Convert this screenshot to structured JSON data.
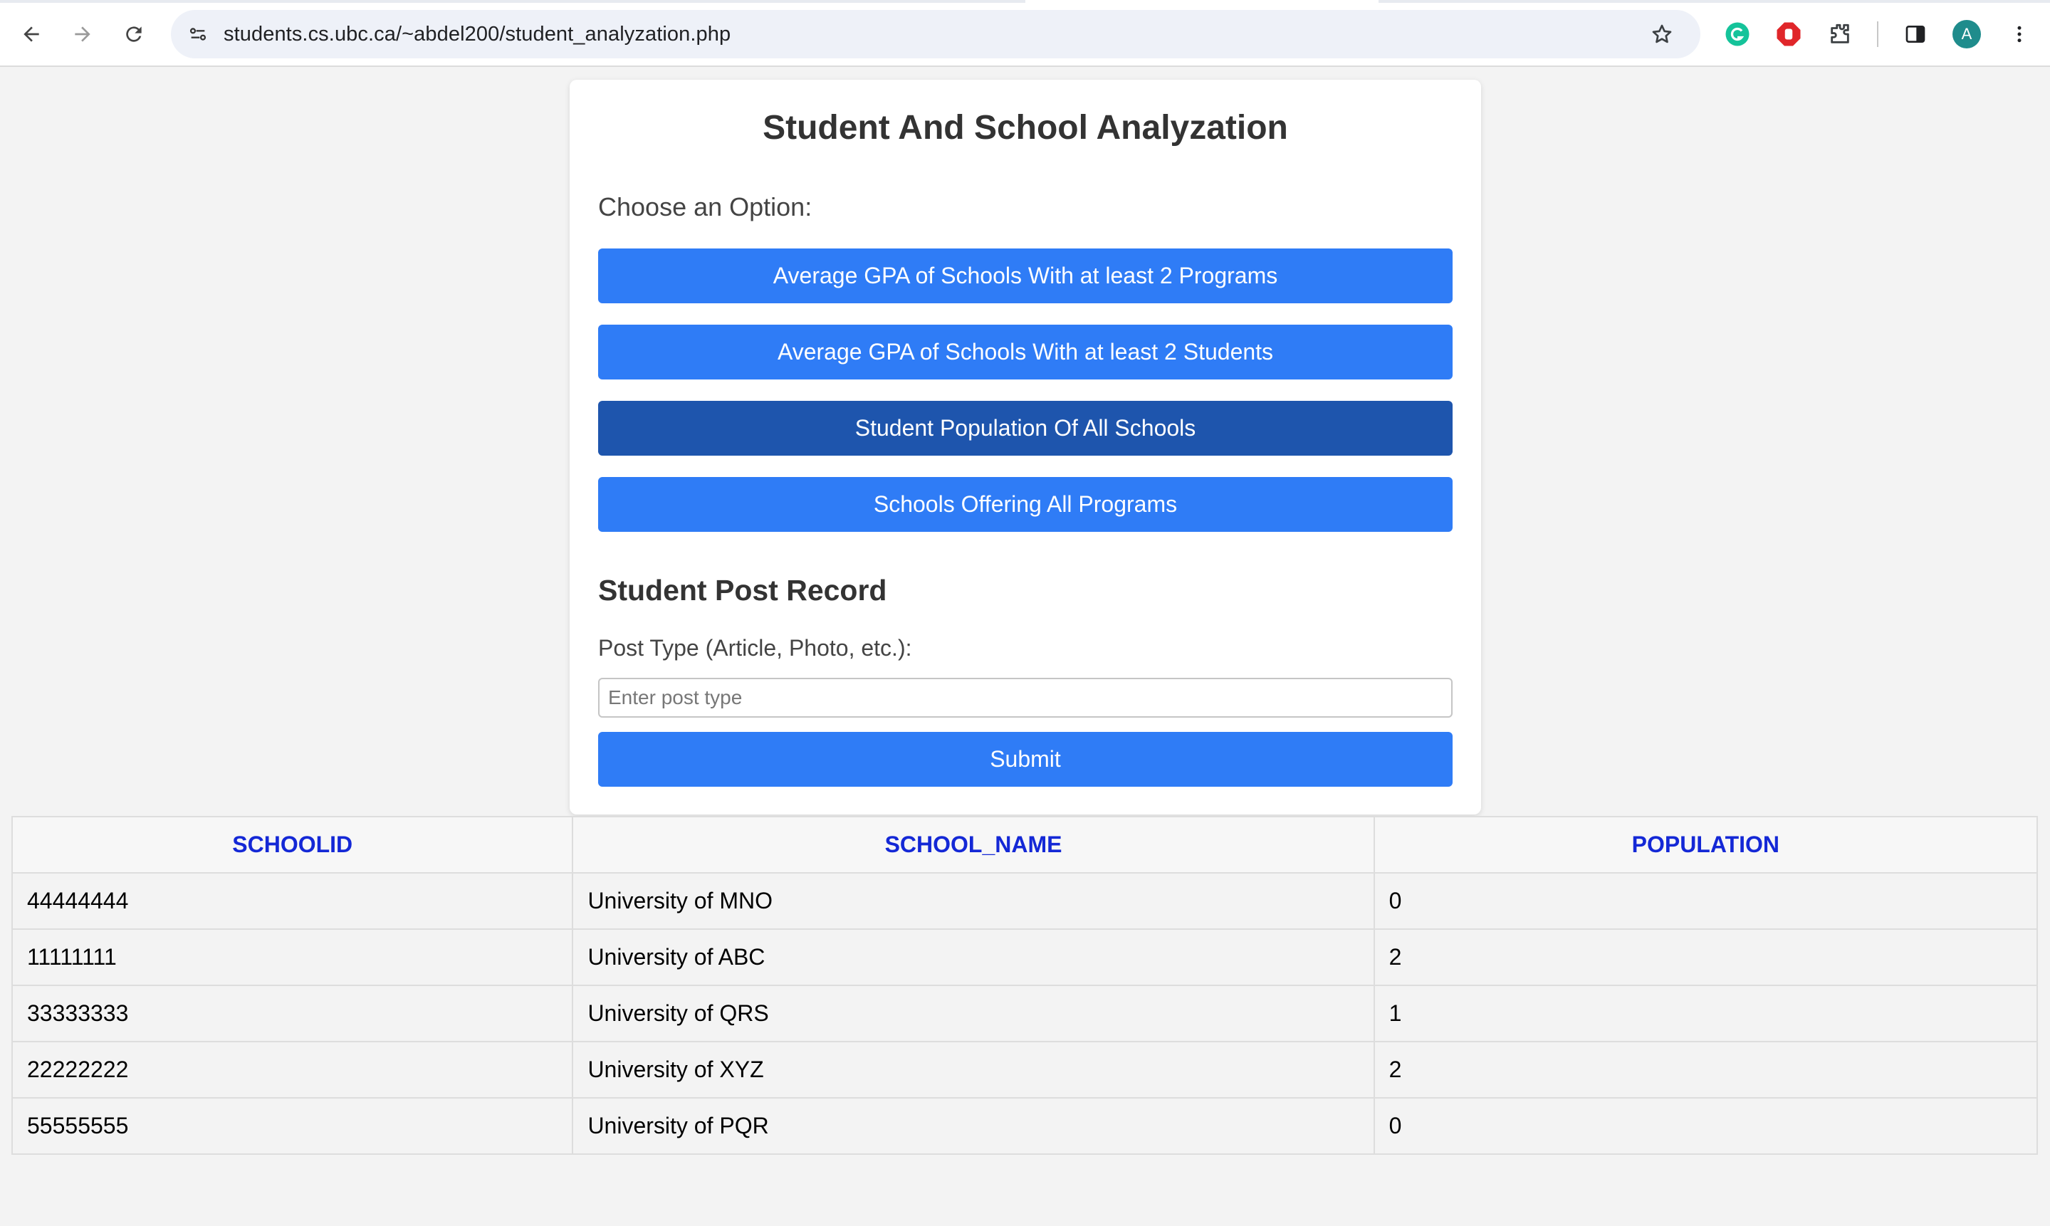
{
  "browser": {
    "url": "students.cs.ubc.ca/~abdel200/student_analyzation.php",
    "avatar_letter": "A",
    "icons": {
      "back": "arrow-left-icon",
      "forward": "arrow-right-icon",
      "reload": "reload-icon",
      "site_info": "tune-icon",
      "bookmark": "star-icon",
      "ext1": "grammarly-icon",
      "ext2": "adblock-icon",
      "ext3": "puzzle-icon",
      "side_panel": "side-panel-icon",
      "menu": "kebab-menu-icon"
    }
  },
  "page": {
    "title": "Student And School Analyzation",
    "choose_label": "Choose an Option:",
    "options": [
      {
        "label": "Average GPA of Schools With at least 2 Programs"
      },
      {
        "label": "Average GPA of Schools With at least 2 Students"
      },
      {
        "label": "Student Population Of All Schools"
      },
      {
        "label": "Schools Offering All Programs"
      }
    ],
    "section_title": "Student Post Record",
    "post_type_label": "Post Type (Article, Photo, etc.):",
    "post_type_placeholder": "Enter post type",
    "post_type_value": "",
    "submit_label": "Submit"
  },
  "colors": {
    "button": "#2f7cf6",
    "button_active": "#1e55ad",
    "table_header_text": "#1428d6"
  },
  "table": {
    "headers": [
      "SCHOOLID",
      "SCHOOL_NAME",
      "POPULATION"
    ],
    "rows": [
      [
        "44444444",
        "University of MNO",
        "0"
      ],
      [
        "11111111",
        "University of ABC",
        "2"
      ],
      [
        "33333333",
        "University of QRS",
        "1"
      ],
      [
        "22222222",
        "University of XYZ",
        "2"
      ],
      [
        "55555555",
        "University of PQR",
        "0"
      ]
    ]
  }
}
